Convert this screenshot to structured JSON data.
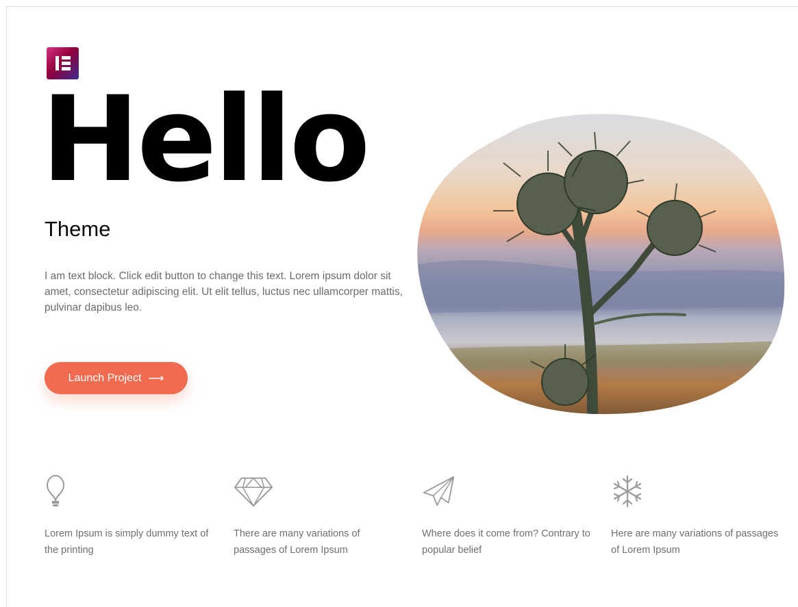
{
  "hero": {
    "heading": "Hello",
    "subheading": "Theme",
    "body": "I am text block. Click edit button to change this text. Lorem ipsum dolor sit amet, consectetur adipiscing elit. Ut elit tellus, luctus nec ullamcorper mattis, pulvinar dapibus leo.",
    "button_label": "Launch Project",
    "button_arrow": "⟶"
  },
  "brand": {
    "logo_icon": "elementor-logo-icon",
    "accent": "#f06b4f"
  },
  "features": [
    {
      "icon": "lightbulb-icon",
      "text": "Lorem Ipsum is simply dummy text of the printing"
    },
    {
      "icon": "diamond-icon",
      "text": "There are many variations of passages of Lorem Ipsum"
    },
    {
      "icon": "paper-plane-icon",
      "text": "Where does it come from? Contrary to popular belief"
    },
    {
      "icon": "snowflake-icon",
      "text": "Here are many variations of passages of Lorem Ipsum"
    }
  ]
}
